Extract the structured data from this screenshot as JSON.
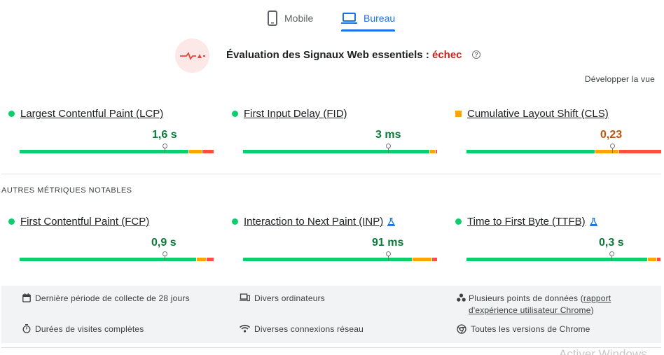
{
  "tabs": {
    "mobile_label": "Mobile",
    "desktop_label": "Bureau",
    "selected": "Bureau"
  },
  "assessment": {
    "prefix": "Évaluation des Signaux Web essentiels : ",
    "status": "échec",
    "expand_label": "Développer la vue"
  },
  "core_metrics": [
    {
      "name": "Largest Contentful Paint (LCP)",
      "value": "1,6 s",
      "status": "good",
      "distribution": [
        0.87,
        0.07,
        0.06
      ],
      "marker": 0.75
    },
    {
      "name": "First Input Delay (FID)",
      "value": "3 ms",
      "status": "good",
      "distribution": [
        0.96,
        0.03,
        0.01
      ],
      "marker": 0.75
    },
    {
      "name": "Cumulative Layout Shift (CLS)",
      "value": "0,23",
      "status": "average",
      "distribution": [
        0.66,
        0.12,
        0.22
      ],
      "marker": 0.75
    }
  ],
  "other_section_label": "AUTRES MÉTRIQUES NOTABLES",
  "other_metrics": [
    {
      "name": "First Contentful Paint (FCP)",
      "value": "0,9 s",
      "status": "good",
      "experimental": false,
      "distribution": [
        0.91,
        0.05,
        0.04
      ],
      "marker": 0.75
    },
    {
      "name": "Interaction to Next Paint (INP)",
      "value": "91 ms",
      "status": "good",
      "experimental": true,
      "distribution": [
        0.87,
        0.1,
        0.03
      ],
      "marker": 0.75
    },
    {
      "name": "Time to First Byte (TTFB)",
      "value": "0,3 s",
      "status": "good",
      "experimental": true,
      "distribution": [
        0.93,
        0.05,
        0.02
      ],
      "marker": 0.75
    }
  ],
  "info": {
    "collection_period": "Dernière période de collecte de 28 jours",
    "devices": "Divers ordinateurs",
    "data_points_prefix": "Plusieurs points de données (",
    "data_points_link": "rapport d'expérience utilisateur Chrome",
    "data_points_suffix": ")",
    "visit_durations": "Durées de visites complètes",
    "connections": "Diverses connexions réseau",
    "chrome_versions": "Toutes les versions de Chrome"
  },
  "watermark": "Activer Windows",
  "colors": {
    "accent": "#1a73e8",
    "good": "#0cce6b",
    "average": "#ffa400",
    "poor": "#ff4e42",
    "fail_text": "#c5221f"
  }
}
